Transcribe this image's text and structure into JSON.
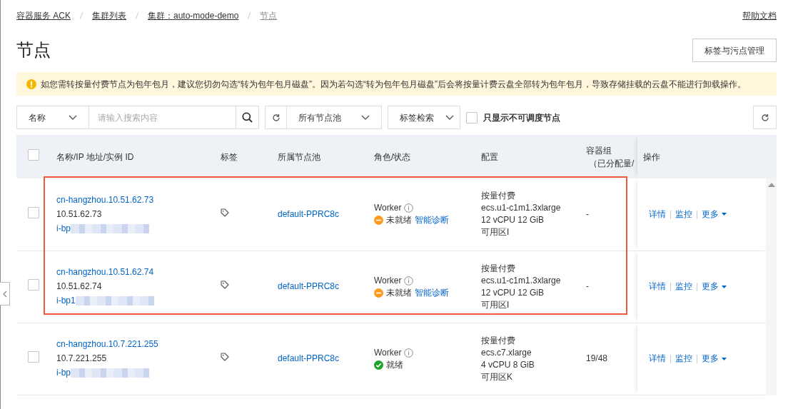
{
  "breadcrumb": [
    {
      "label": "容器服务 ACK",
      "current": false
    },
    {
      "label": "集群列表",
      "current": false
    },
    {
      "label": "集群：auto-mode-demo",
      "current": false
    },
    {
      "label": "节点",
      "current": true
    }
  ],
  "help_link": "帮助文档",
  "title": "节点",
  "manage_button": "标签与污点管理",
  "alert": "如您需转按量付费节点为包年包月，建议您切勿勾选“转为包年包月磁盘”。因为若勾选“转为包年包月磁盘”后会将按量计费云盘全部转为包年包月，导致存储挂载的云盘不能进行卸载操作。",
  "filter": {
    "field": "名称",
    "placeholder": "请输入搜索内容",
    "pool": "所有节点池",
    "tag_search": "标签检索",
    "unschedulable_only": {
      "label": "只显示不可调度节点",
      "checked": false
    }
  },
  "table": {
    "all_selected": false,
    "columns": [
      {
        "label": "名称/IP 地址/实例 ID"
      },
      {
        "label": "标签"
      },
      {
        "label": "所属节点池"
      },
      {
        "label": "角色/状态"
      },
      {
        "label": "配置"
      },
      {
        "label": "容器组",
        "sublabel": "（已分配量/"
      },
      {
        "label": "操作"
      }
    ],
    "rows": [
      {
        "selected": false,
        "highlighted": true,
        "name": "cn-hangzhou.10.51.62.73",
        "ip": "10.51.62.73",
        "instance_id": "i-bp",
        "pool": "default-PPRC8c",
        "role": "Worker",
        "status": {
          "kind": "pending",
          "label": "未就绪",
          "action": "智能诊断"
        },
        "billing": "按量付费",
        "instance_type": "ecs.u1-c1m1.3xlarge",
        "spec": "12 vCPU 12 GiB",
        "zone": "可用区I",
        "pods": "-",
        "actions": [
          "详情",
          "监控",
          "更多"
        ]
      },
      {
        "selected": false,
        "highlighted": true,
        "name": "cn-hangzhou.10.51.62.74",
        "ip": "10.51.62.74",
        "instance_id": "i-bp1",
        "pool": "default-PPRC8c",
        "role": "Worker",
        "status": {
          "kind": "pending",
          "label": "未就绪",
          "action": "智能诊断"
        },
        "billing": "按量付费",
        "instance_type": "ecs.u1-c1m1.3xlarge",
        "spec": "12 vCPU 12 GiB",
        "zone": "可用区I",
        "pods": "-",
        "actions": [
          "详情",
          "监控",
          "更多"
        ]
      },
      {
        "selected": false,
        "highlighted": false,
        "name": "cn-hangzhou.10.7.221.255",
        "ip": "10.7.221.255",
        "instance_id": "i-bp",
        "pool": "default-PPRC8c",
        "role": "Worker",
        "status": {
          "kind": "ready",
          "label": "就绪"
        },
        "billing": "按量付费",
        "instance_type": "ecs.c7.xlarge",
        "spec": "4 vCPU 8 GiB",
        "zone": "可用区K",
        "pods": "19/48",
        "actions": [
          "详情",
          "监控",
          "更多"
        ]
      }
    ]
  }
}
